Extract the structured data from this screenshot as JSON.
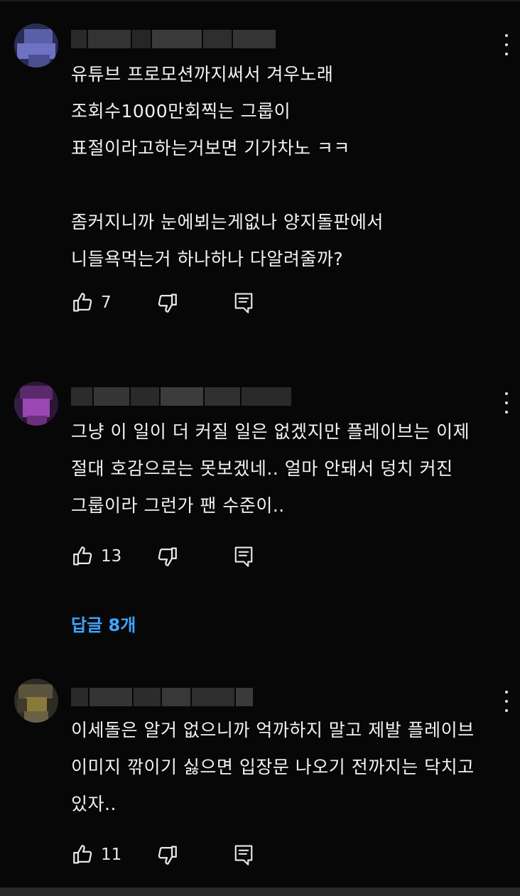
{
  "comments": [
    {
      "text": "유튜브 프로모션까지써서 겨우노래\n조회수1000만회찍는 그룹이\n표절이라고하는거보면 기가차노 ㅋㅋ\n\n좀커지니까 눈에뵈는게없나 양지돌판에서\n니들욕먹는거 하나하나 다알려줄까?",
      "like_count": "7",
      "avatar_color": "#5b5fa8"
    },
    {
      "text": "그냥 이 일이 더 커질 일은 없겠지만 플레이브는 이제\n절대 호감으로는 못보겠네.. 얼마 안돼서 덩치 커진\n그룹이라 그런가 팬 수준이..",
      "like_count": "13",
      "replies_label": "답글 8개",
      "avatar_color": "#8a3fa0"
    },
    {
      "text": "이세돌은 알거 없으니까 억까하지 말고 제발 플레이브\n이미지 깎이기 싫으면 입장문 나오기 전까지는 닥치고\n있자..",
      "like_count": "11",
      "avatar_color": "#8a7a3a"
    }
  ],
  "icons": {
    "like": "thumbs-up-icon",
    "dislike": "thumbs-down-icon",
    "reply": "reply-icon",
    "more": "more-vert-icon"
  },
  "colors": {
    "background": "#070707",
    "text": "#f2f2f2",
    "link": "#3ea6ff"
  }
}
